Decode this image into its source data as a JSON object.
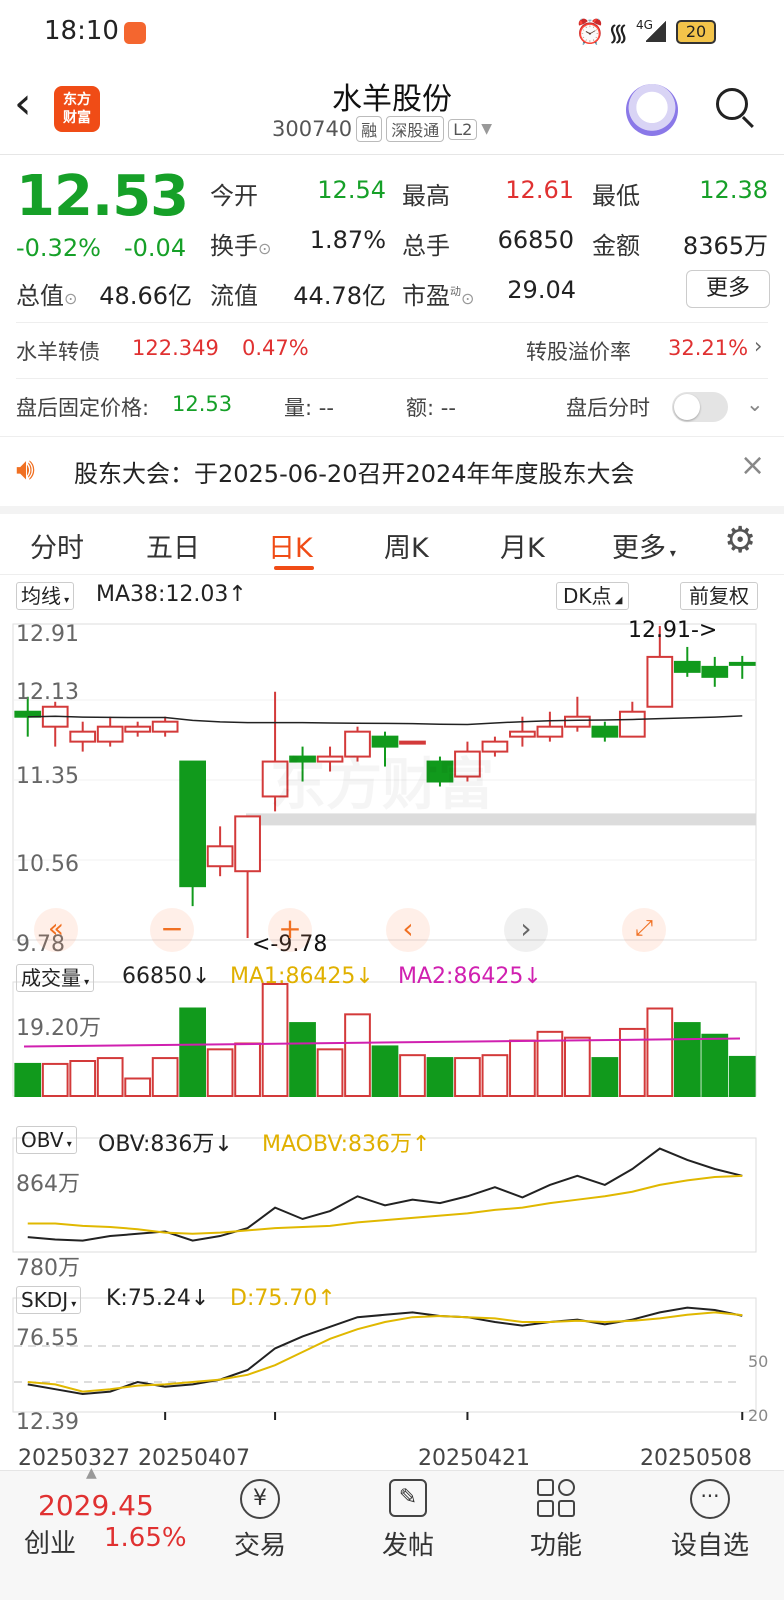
{
  "status_bar": {
    "time": "18:10",
    "battery": "20",
    "network": "4G"
  },
  "header": {
    "title": "水羊股份",
    "code": "300740",
    "tags": [
      "融",
      "深股通",
      "L2"
    ],
    "logo_text_1": "东方",
    "logo_text_2": "财富"
  },
  "quote": {
    "price": "12.53",
    "change_pct": "-0.32%",
    "change_amt": "-0.04",
    "open_label": "今开",
    "open": "12.54",
    "high_label": "最高",
    "high": "12.61",
    "low_label": "最低",
    "low": "12.38",
    "turnover_label": "换手",
    "turnover": "1.87%",
    "volume_label": "总手",
    "volume": "66850",
    "amount_label": "金额",
    "amount": "8365万",
    "mktcap_label": "总值",
    "mktcap": "48.66亿",
    "float_label": "流值",
    "float": "44.78亿",
    "pe_label": "市盈",
    "pe_sup": "动",
    "pe": "29.04",
    "more_button": "更多"
  },
  "bond": {
    "name": "水羊转债",
    "price": "122.349",
    "pct": "0.47%",
    "premium_label": "转股溢价率",
    "premium": "32.21%"
  },
  "after_hours": {
    "price_label": "盘后固定价格:",
    "price": "12.53",
    "vol_label": "量: --",
    "amt_label": "额: --",
    "toggle_label": "盘后分时"
  },
  "notice": {
    "text": "股东大会：于2025-06-20召开2024年年度股东大会"
  },
  "tabs": [
    "分时",
    "五日",
    "日K",
    "周K",
    "月K",
    "更多"
  ],
  "active_tab": 2,
  "main_chart": {
    "ma_selector": "均线",
    "ma_text": "MA38:12.03↑",
    "dk_button": "DK点",
    "adjust_button": "前复权",
    "y_labels": [
      "12.91",
      "12.13",
      "11.35",
      "10.56",
      "9.78"
    ],
    "high_marker": "12.91->",
    "low_marker": "<-9.78",
    "watermark": "东方财富"
  },
  "volume_chart": {
    "selector": "成交量",
    "value": "66850↓",
    "ma1": "MA1:86425↓",
    "ma2": "MA2:86425↓",
    "y_label": "19.20万"
  },
  "obv_chart": {
    "selector": "OBV",
    "value": "OBV:836万↓",
    "ma": "MAOBV:836万↑",
    "y_top": "864万",
    "y_bottom": "780万"
  },
  "kdj_chart": {
    "selector": "SKDJ",
    "k": "K:75.24↓",
    "d": "D:75.70↑",
    "y_top": "76.55",
    "y_bottom": "12.39",
    "ref50": "50",
    "ref20": "20"
  },
  "x_dates": [
    "20250327",
    "20250407",
    "20250421",
    "20250508"
  ],
  "bottom_nav": {
    "index_value": "2029.45",
    "index_name": "创业",
    "index_pct": "1.65%",
    "items": [
      "交易",
      "发帖",
      "功能",
      "设自选"
    ]
  },
  "chart_data": {
    "type": "candlestick",
    "candles": [
      {
        "o": 12.05,
        "c": 12.0,
        "h": 12.2,
        "l": 11.8
      },
      {
        "o": 11.9,
        "c": 12.1,
        "h": 12.15,
        "l": 11.7
      },
      {
        "o": 11.75,
        "c": 11.85,
        "h": 11.95,
        "l": 11.65
      },
      {
        "o": 11.75,
        "c": 11.9,
        "h": 12.0,
        "l": 11.7
      },
      {
        "o": 11.85,
        "c": 11.9,
        "h": 11.95,
        "l": 11.8
      },
      {
        "o": 11.85,
        "c": 11.95,
        "h": 12.0,
        "l": 11.8
      },
      {
        "o": 11.55,
        "c": 10.3,
        "h": 11.55,
        "l": 10.1
      },
      {
        "o": 10.5,
        "c": 10.7,
        "h": 10.9,
        "l": 10.4
      },
      {
        "o": 10.45,
        "c": 11.0,
        "h": 11.0,
        "l": 9.78
      },
      {
        "o": 11.2,
        "c": 11.55,
        "h": 12.25,
        "l": 11.05
      },
      {
        "o": 11.6,
        "c": 11.55,
        "h": 11.7,
        "l": 11.35
      },
      {
        "o": 11.55,
        "c": 11.6,
        "h": 11.7,
        "l": 11.45
      },
      {
        "o": 11.6,
        "c": 11.85,
        "h": 11.9,
        "l": 11.55
      },
      {
        "o": 11.8,
        "c": 11.7,
        "h": 11.85,
        "l": 11.5
      },
      {
        "o": 11.75,
        "c": 11.75,
        "h": 11.75,
        "l": 11.75
      },
      {
        "o": 11.55,
        "c": 11.35,
        "h": 11.6,
        "l": 11.3
      },
      {
        "o": 11.4,
        "c": 11.65,
        "h": 11.75,
        "l": 11.35
      },
      {
        "o": 11.65,
        "c": 11.75,
        "h": 11.8,
        "l": 11.6
      },
      {
        "o": 11.8,
        "c": 11.85,
        "h": 12.0,
        "l": 11.7
      },
      {
        "o": 11.8,
        "c": 11.9,
        "h": 12.05,
        "l": 11.75
      },
      {
        "o": 11.9,
        "c": 12.0,
        "h": 12.2,
        "l": 11.85
      },
      {
        "o": 11.9,
        "c": 11.8,
        "h": 11.95,
        "l": 11.75
      },
      {
        "o": 11.8,
        "c": 12.05,
        "h": 12.15,
        "l": 11.8
      },
      {
        "o": 12.1,
        "c": 12.6,
        "h": 12.91,
        "l": 12.1
      },
      {
        "o": 12.55,
        "c": 12.45,
        "h": 12.7,
        "l": 12.4
      },
      {
        "o": 12.5,
        "c": 12.4,
        "h": 12.6,
        "l": 12.3
      },
      {
        "o": 12.54,
        "c": 12.53,
        "h": 12.61,
        "l": 12.38
      }
    ],
    "volumes": [
      5.5,
      5.5,
      6.0,
      6.5,
      3.0,
      6.5,
      15.0,
      8.0,
      9.0,
      19.2,
      12.5,
      8.0,
      14.0,
      8.5,
      7.0,
      6.5,
      6.5,
      7.0,
      9.5,
      11.0,
      10.0,
      6.5,
      11.5,
      15.0,
      12.5,
      10.5,
      6.7
    ],
    "obv": [
      782,
      780,
      779,
      783,
      785,
      787,
      779,
      783,
      790,
      808,
      798,
      805,
      818,
      810,
      815,
      812,
      818,
      826,
      817,
      828,
      836,
      828,
      842,
      860,
      850,
      842,
      836
    ],
    "obv_ma": [
      794,
      794,
      792,
      791,
      789,
      786,
      785,
      786,
      788,
      790,
      791,
      792,
      795,
      797,
      799,
      801,
      803,
      806,
      808,
      812,
      815,
      818,
      822,
      828,
      832,
      835,
      836
    ],
    "k": [
      18,
      14,
      10,
      12,
      20,
      16,
      18,
      22,
      30,
      48,
      58,
      66,
      74,
      76,
      78,
      75,
      74,
      70,
      67,
      70,
      72,
      68,
      72,
      78,
      82,
      80,
      75.24
    ],
    "d": [
      20,
      18,
      12,
      14,
      17,
      18,
      20,
      22,
      26,
      34,
      45,
      56,
      64,
      70,
      74,
      75,
      74,
      73,
      70,
      70,
      71,
      70,
      71,
      73,
      76,
      78,
      75.7
    ],
    "ylim": [
      9.78,
      12.91
    ]
  }
}
